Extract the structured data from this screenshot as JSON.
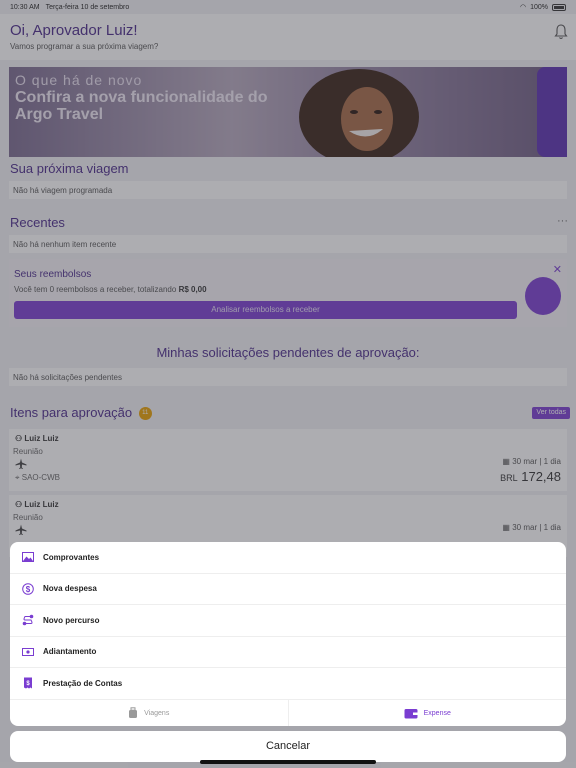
{
  "status": {
    "time": "10:30 AM",
    "date": "Terça-feira 10 de setembro",
    "battery": "100%"
  },
  "header": {
    "greeting": "Oi, Aprovador Luiz!",
    "subtitle": "Vamos programar a sua próxima viagem?"
  },
  "banner": {
    "kicker": "O que há de novo",
    "headline": "Confira a nova funcionalidade do Argo Travel"
  },
  "next_trip": {
    "title": "Sua próxima viagem",
    "empty": "Não há viagem programada"
  },
  "recent": {
    "title": "Recentes",
    "empty": "Não há nenhum item recente"
  },
  "reimbursements": {
    "title": "Seus reembolsos",
    "text": "Você tem 0 reembolsos a receber, totalizando",
    "amount": "R$ 0,00",
    "button": "Analisar reembolsos a receber"
  },
  "pending": {
    "title": "Minhas solicitações pendentes de aprovação:",
    "empty": "Não há solicitações pendentes"
  },
  "approvals": {
    "title": "Itens para aprovação",
    "count": "11",
    "see_all": "Ver todas",
    "items": [
      {
        "name": "Luiz Luiz",
        "reason": "Reunião",
        "route": "SAO-CWB",
        "date": "30 mar | 1 dia",
        "currency": "BRL",
        "amount": "172,48"
      },
      {
        "name": "Luiz Luiz",
        "reason": "Reunião",
        "date": "30 mar | 1 dia"
      }
    ]
  },
  "action_sheet": {
    "items": [
      {
        "label": "Comprovantes",
        "icon": "image-icon"
      },
      {
        "label": "Nova despesa",
        "icon": "dollar-circle-icon"
      },
      {
        "label": "Novo percurso",
        "icon": "route-icon"
      },
      {
        "label": "Adiantamento",
        "icon": "cash-icon"
      },
      {
        "label": "Prestação de Contas",
        "icon": "receipt-icon"
      }
    ],
    "tabs": [
      {
        "label": "Viagens",
        "icon": "luggage-icon"
      },
      {
        "label": "Expense",
        "icon": "wallet-icon"
      }
    ],
    "cancel": "Cancelar"
  },
  "colors": {
    "brand": "#7a3dd1",
    "title": "#4a2a8a",
    "badge": "#e8a000"
  }
}
